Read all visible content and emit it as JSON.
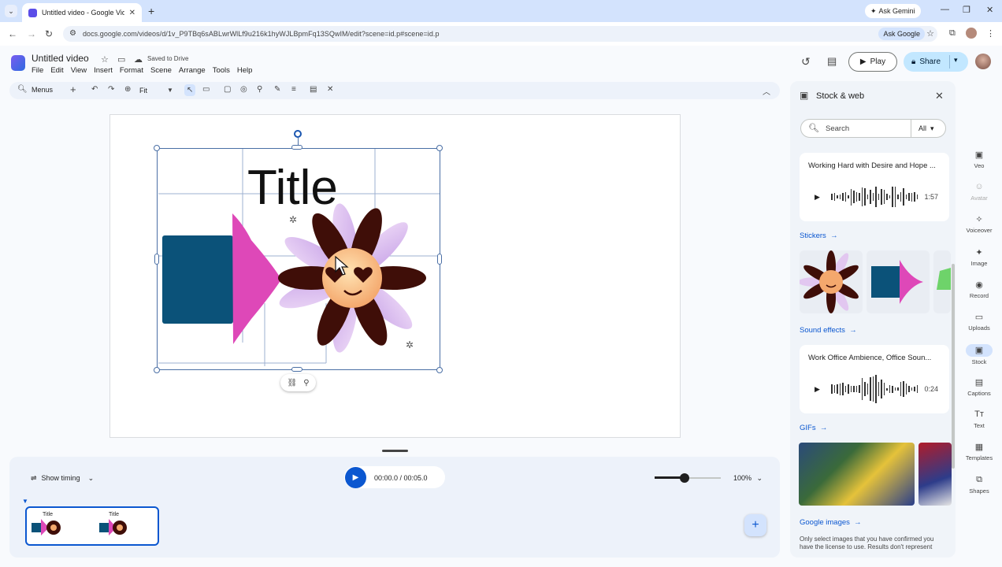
{
  "browser": {
    "tab_title": "Untitled video - Google Vids",
    "ask_gemini": "Ask Gemini",
    "url": "docs.google.com/videos/d/1v_P9TBq6sABLwrWlLf9u216k1hyWJLBpmFq13SQwIM/edit?scene=id.p#scene=id.p",
    "ask_google": "Ask Google"
  },
  "header": {
    "title": "Untitled video",
    "saved_status": "Saved to Drive",
    "menu": [
      "File",
      "Edit",
      "View",
      "Insert",
      "Format",
      "Scene",
      "Arrange",
      "Tools",
      "Help"
    ],
    "play_label": "Play",
    "share_label": "Share"
  },
  "toolbar": {
    "menus_label": "Menus",
    "zoom_fit": "Fit"
  },
  "canvas": {
    "title_text": "Title",
    "colors": {
      "rect": "#0b5279",
      "triangle": "#de48b8",
      "petal_dark": "#3f0e08",
      "petal_light": "#e2c7f0"
    }
  },
  "timeline": {
    "show_timing": "Show timing",
    "timecode": "00:00.0 / 00:05.0",
    "zoom": "100%",
    "zoom_level": 0.45,
    "thumb_title_1": "Title",
    "thumb_title_2": "Title"
  },
  "panel": {
    "title": "Stock & web",
    "search_placeholder": "Search",
    "filter_value": "All",
    "audio_1": {
      "title": "Working Hard with Desire and Hope ...",
      "duration": "1:57"
    },
    "stickers_label": "Stickers",
    "sound_effects_label": "Sound effects",
    "audio_2": {
      "title": "Work Office Ambience, Office Soun...",
      "duration": "0:24"
    },
    "gifs_label": "GIFs",
    "google_images_label": "Google images",
    "disclaimer": "Only select images that you have confirmed you have the license to use. Results don't represent"
  },
  "rail": [
    {
      "label": "Veo",
      "icon": "veo-icon"
    },
    {
      "label": "Avatar",
      "icon": "avatar-icon"
    },
    {
      "label": "Voiceover",
      "icon": "voiceover-icon"
    },
    {
      "label": "Image",
      "icon": "image-icon"
    },
    {
      "label": "Record",
      "icon": "record-icon"
    },
    {
      "label": "Uploads",
      "icon": "uploads-icon"
    },
    {
      "label": "Stock",
      "icon": "stock-icon"
    },
    {
      "label": "Captions",
      "icon": "captions-icon"
    },
    {
      "label": "Text",
      "icon": "text-icon"
    },
    {
      "label": "Templates",
      "icon": "templates-icon"
    },
    {
      "label": "Shapes",
      "icon": "shapes-icon"
    }
  ]
}
